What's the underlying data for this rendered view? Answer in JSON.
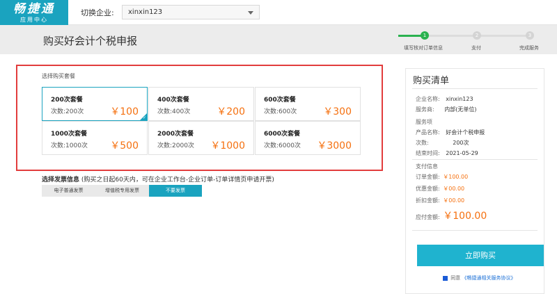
{
  "logo": {
    "main": "畅捷通",
    "sub": "应用中心"
  },
  "header": {
    "switch_label": "切换企业:",
    "company": "xinxin123"
  },
  "page": {
    "title": "购买好会计个税申报"
  },
  "steps": [
    {
      "num": "1",
      "label": "填写核对订单信息"
    },
    {
      "num": "2",
      "label": "支付"
    },
    {
      "num": "3",
      "label": "完成服务"
    }
  ],
  "packages": {
    "section_label": "选择购买套餐",
    "items": [
      {
        "name": "200次套餐",
        "count": "次数:200次",
        "price": "￥100"
      },
      {
        "name": "400次套餐",
        "count": "次数:400次",
        "price": "￥200"
      },
      {
        "name": "600次套餐",
        "count": "次数:600次",
        "price": "￥300"
      },
      {
        "name": "1000次套餐",
        "count": "次数:1000次",
        "price": "￥500"
      },
      {
        "name": "2000次套餐",
        "count": "次数:2000次",
        "price": "￥1000"
      },
      {
        "name": "6000次套餐",
        "count": "次数:6000次",
        "price": "￥3000"
      }
    ],
    "selected": 0
  },
  "invoice": {
    "label": "选择发票信息",
    "note": "(购买之日起60天内，可在企业工作台-企业订单-订单详情页申请开票)",
    "options": [
      "电子普通发票",
      "增值税专用发票",
      "不要发票"
    ],
    "selected": 2
  },
  "cart": {
    "title": "购买清单",
    "company_label": "企业名称:",
    "company_value": "xinxin123",
    "provider_label": "服务商:",
    "provider_value": "内部(无单位)",
    "service_section": "服务项",
    "product_label": "产品名称:",
    "product_value": "好会计个税申报",
    "times_label": "次数:",
    "times_value": "200次",
    "end_label": "结束时间:",
    "end_value": "2021-05-29",
    "pay_section": "支付信息",
    "order_amount_label": "订单金额:",
    "order_amount": "￥100.00",
    "discount_label": "优惠金额:",
    "discount": "￥00.00",
    "rebate_label": "折扣金额:",
    "rebate": "￥00.00",
    "payable_label": "应付金额:",
    "payable": "￥100.00",
    "buy_button": "立即购买",
    "agree_text": "同意",
    "agreement_link": "《畅捷通相关服务协议》"
  },
  "colors": {
    "accent": "#1aa3bf",
    "price": "#f5700f",
    "highlight": "#e23c3c"
  }
}
